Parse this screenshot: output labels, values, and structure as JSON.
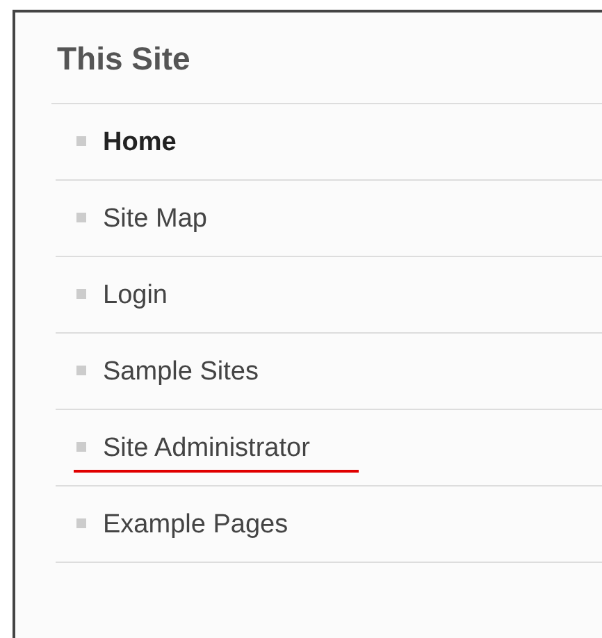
{
  "panel": {
    "title": "This Site",
    "items": [
      {
        "label": "Home",
        "selected": true,
        "underlined": false
      },
      {
        "label": "Site Map",
        "selected": false,
        "underlined": false
      },
      {
        "label": "Login",
        "selected": false,
        "underlined": false
      },
      {
        "label": "Sample Sites",
        "selected": false,
        "underlined": false
      },
      {
        "label": "Site Administrator",
        "selected": false,
        "underlined": true
      },
      {
        "label": "Example Pages",
        "selected": false,
        "underlined": false
      }
    ]
  }
}
